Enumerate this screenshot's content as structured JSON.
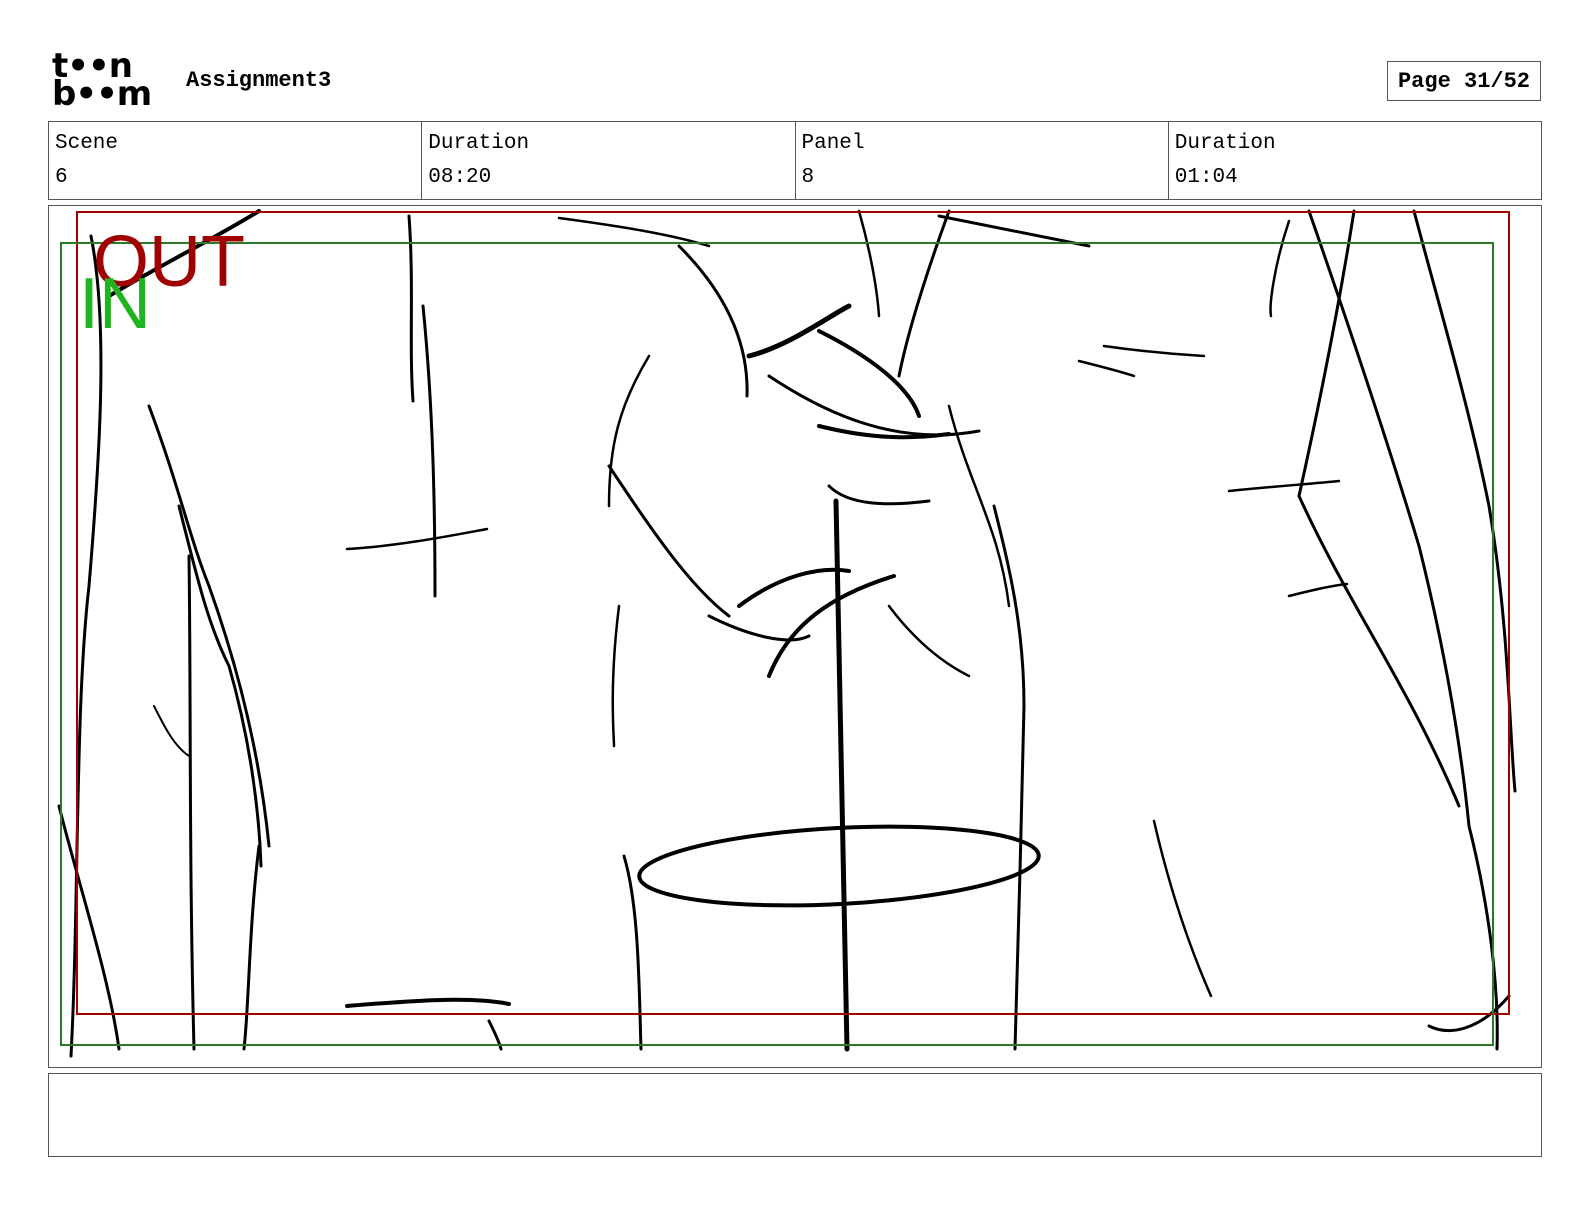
{
  "header": {
    "logo_line1": "t••n",
    "logo_line2": "b••m",
    "project_title": "Assignment3",
    "page_label": "Page 31/52"
  },
  "info": {
    "scene_label": "Scene",
    "scene_value": "6",
    "scene_duration_label": "Duration",
    "scene_duration_value": "08:20",
    "panel_label": "Panel",
    "panel_value": "8",
    "panel_duration_label": "Duration",
    "panel_duration_value": "01:04"
  },
  "frame": {
    "out_label": "OUT",
    "in_label": "IN",
    "out_color": "#a00000",
    "in_color": "#1fb31f"
  },
  "notes": {
    "text": ""
  }
}
